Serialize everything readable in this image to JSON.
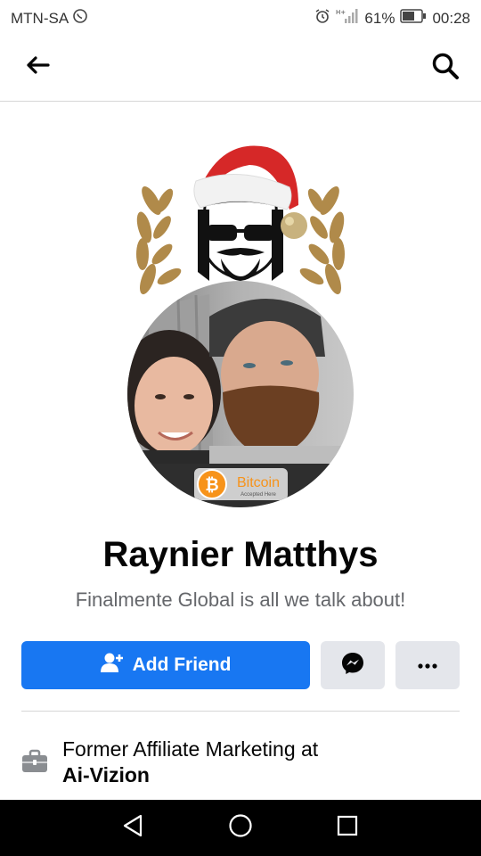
{
  "status_bar": {
    "carrier": "MTN-SA",
    "battery": "61%",
    "time": "00:28"
  },
  "nav": {
    "back_icon": "back-arrow-icon",
    "search_icon": "search-icon"
  },
  "profile": {
    "name": "Raynier Matthys",
    "bio": "Finalmente Global is all we talk about!",
    "badge_text": "Bitcoin",
    "badge_subtext": "Accepted Here"
  },
  "actions": {
    "add_friend_label": "Add Friend",
    "messenger_icon": "messenger-icon",
    "more_icon": "more-dots-icon"
  },
  "intro": {
    "work_prefix": "Former Affiliate Marketing at",
    "work_company": "Ai-Vizion"
  },
  "colors": {
    "primary": "#1877f2",
    "secondary_button": "#e4e6eb",
    "text": "#050505",
    "muted_text": "#65676b"
  }
}
